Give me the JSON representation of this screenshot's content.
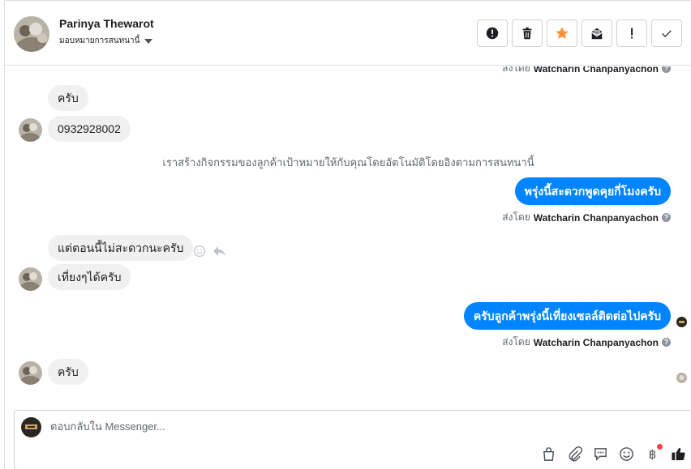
{
  "header": {
    "contact_name": "Parinya Thewarot",
    "assign_label": "มอบหมายการสนทนานี้"
  },
  "toolbar": {
    "buttons": [
      "spam-icon",
      "trash-icon",
      "star-icon",
      "mark-unread-icon",
      "important-icon",
      "done-check-icon"
    ],
    "star_color": "#f7923b"
  },
  "thread": {
    "top_sent_by_prefix": "ส่งโดย",
    "top_sent_by_name": "Watcharin Chanpanyachon",
    "msg1": "ครับ",
    "msg2": "0932928002",
    "system_note": "เราสร้างกิจกรรมของลูกค้าเป้าหมายให้กับคุณโดยอัตโนมัติโดยอิงตามการสนทนานี้",
    "out1": "พรุ่งนี้สะดวกพูดคุยกี่โมงครับ",
    "out1_sent_prefix": "ส่งโดย",
    "out1_sent_name": "Watcharin Chanpanyachon",
    "msg3": "แต่ตอนนี้ไม่สะดวกนะครับ",
    "msg4": "เที่ยงๆได้ครับ",
    "out2": "ครับลูกค้าพรุ่งนี้เที่ยงเซลล์ติดต่อไปครับ",
    "out2_sent_prefix": "ส่งโดย",
    "out2_sent_name": "Watcharin Chanpanyachon",
    "msg5": "ครับ",
    "outgoing_color": "#0084ff"
  },
  "composer": {
    "placeholder": "ตอบกลับใน Messenger...",
    "tools": [
      "shopping-bag-icon",
      "attachment-icon",
      "saved-replies-icon",
      "emoji-icon",
      "baht-payment-icon",
      "thumbs-up-icon"
    ]
  }
}
